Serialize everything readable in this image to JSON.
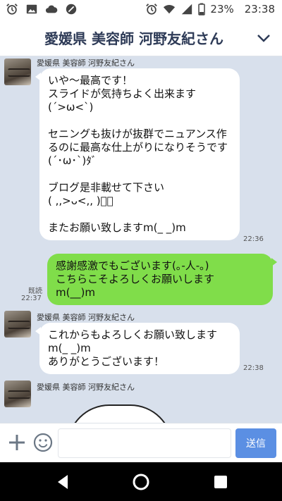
{
  "status_bar": {
    "battery_percent": "23%",
    "time": "23:38"
  },
  "header": {
    "title": "愛媛県 美容師 河野友紀さん"
  },
  "messages": [
    {
      "sender": "愛媛県 美容師 河野友紀さん",
      "text": "いや〜最高です！\nスライドが気持ちよく出来ます\n(´>ω<`)\n\nセニングも抜けが抜群でニュアンス作るのに最高な仕上がりになりそうです(´･ω･`)ﾀﾞ\n\nブログ是非載せて下さい\n( ,,>ᴗ<,, )ﾞﾞ\n\nまたお願い致しますm(_ _)m",
      "time": "22:36"
    },
    {
      "text": "感謝感激でもございます(｡-人-｡)\nこちらこそよろしくお願いします\nm(__)m",
      "read": "既読",
      "time": "22:37"
    },
    {
      "sender": "愛媛県 美容師 河野友紀さん",
      "text": "これからもよろしくお願い致します\nm(_ _)m\nありがとうございます！",
      "time": "22:38"
    },
    {
      "sender": "愛媛県 美容師 河野友紀さん"
    }
  ],
  "input": {
    "placeholder": "",
    "send_label": "送信"
  },
  "icons": {
    "status_left": [
      "alarm-icon",
      "image-icon",
      "cloud-icon",
      "blocked-icon"
    ],
    "status_right": [
      "alarm-icon",
      "wifi-icon",
      "signal-icon",
      "battery-icon"
    ],
    "header": "chevron-down-icon",
    "input": [
      "plus-icon",
      "emoji-icon"
    ],
    "nav": [
      "back-icon",
      "home-icon",
      "recents-icon"
    ]
  },
  "colors": {
    "incoming_bubble": "#ffffff",
    "outgoing_bubble": "#80dd4a",
    "chat_background": "#d8e0ec",
    "send_button": "#5b8fe3",
    "header_title": "#2e3b57"
  }
}
